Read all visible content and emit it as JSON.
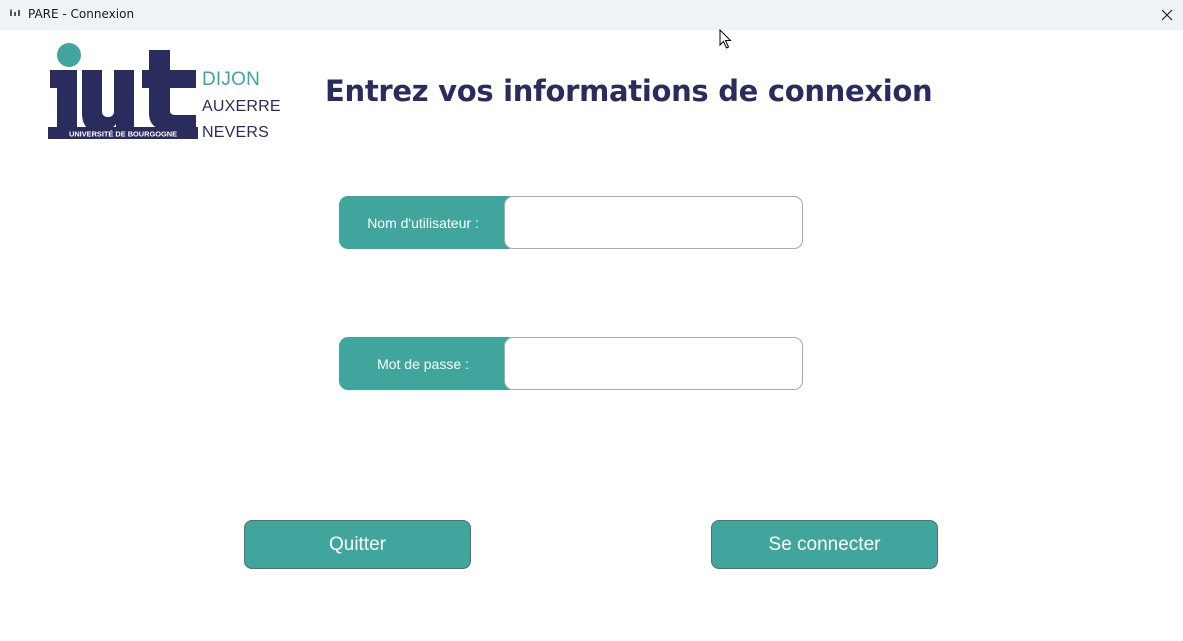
{
  "window": {
    "title": "PARE - Connexion",
    "app_icon": "app-icon",
    "close_icon": "close-icon"
  },
  "logo": {
    "wordmark": "iut",
    "subtitle": "UNIVERSITÉ DE BOURGOGNE",
    "cities": [
      "DIJON",
      "AUXERRE",
      "NEVERS"
    ]
  },
  "heading": "Entrez vos informations de connexion",
  "form": {
    "username_label": "Nom d'utilisateur :",
    "username_value": "",
    "password_label": "Mot de passe :",
    "password_value": ""
  },
  "buttons": {
    "quit_label": "Quitter",
    "connect_label": "Se connecter"
  },
  "colors": {
    "accent": "#3fa59d",
    "brand_dark": "#2a2c5e",
    "titlebar": "#eff3f8"
  }
}
